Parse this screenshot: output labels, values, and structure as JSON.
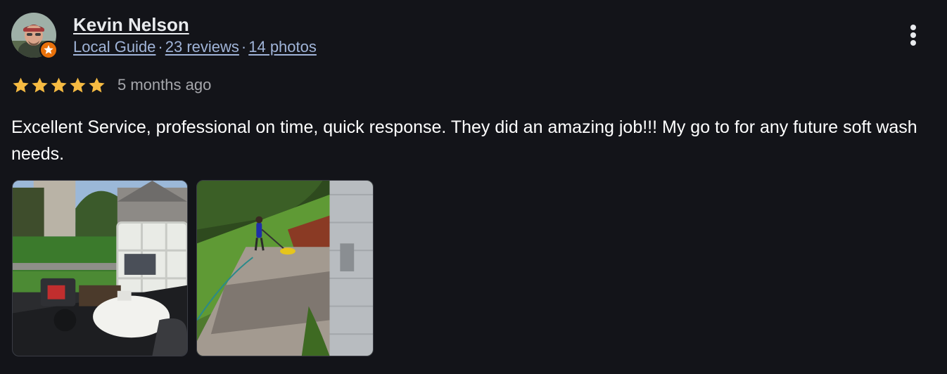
{
  "review": {
    "author_name": "Kevin Nelson",
    "guide_label": "Local Guide",
    "separator": "·",
    "reviews_count": "23 reviews",
    "photos_count": "14 photos",
    "rating": 5,
    "rating_max": 5,
    "time_ago": "5 months ago",
    "text": "Excellent Service, professional on time, quick response. They did an amazing job!!! My go to for any future soft wash needs.",
    "photos": [
      {
        "icon": "photo-trailer-tank-equipment"
      },
      {
        "icon": "photo-worker-surface-cleaning-patio"
      }
    ]
  },
  "icons": {
    "avatar": "user-avatar",
    "badge": "local-guide-star-badge",
    "more": "more-vert-icon",
    "star": "star-icon"
  },
  "colors": {
    "background": "#131419",
    "name": "#e8eaed",
    "meta_link": "#a0b4d8",
    "star": "#f6bb42",
    "badge": "#e8710a",
    "text": "#ffffff",
    "muted": "#a5a6ab"
  }
}
